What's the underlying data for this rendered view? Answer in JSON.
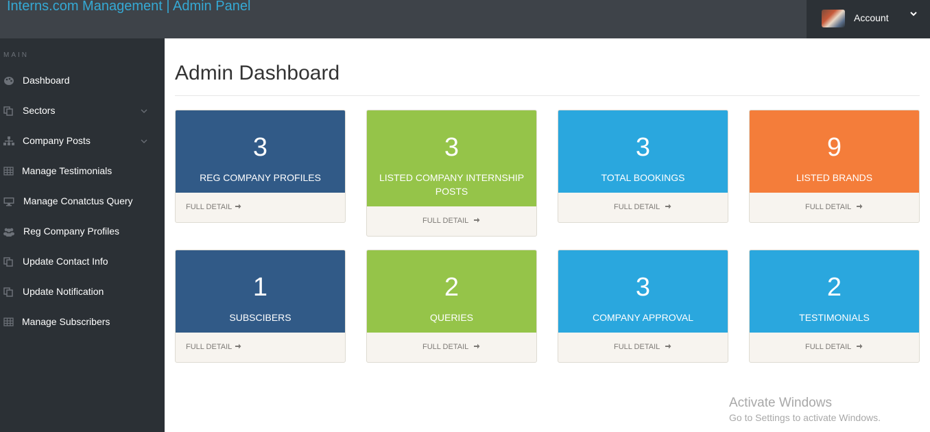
{
  "header": {
    "brand": "Interns.com Management | Admin Panel",
    "account_label": "Account"
  },
  "sidebar": {
    "heading": "MAIN",
    "items": [
      {
        "label": "Dashboard",
        "icon": "palette-icon"
      },
      {
        "label": "Sectors",
        "icon": "copy-icon",
        "has_submenu": true
      },
      {
        "label": "Company Posts",
        "icon": "sitemap-icon",
        "has_submenu": true
      },
      {
        "label": "Manage Testimonials",
        "icon": "table-icon"
      },
      {
        "label": "Manage Conatctus Query",
        "icon": "desktop-icon"
      },
      {
        "label": "Reg Company Profiles",
        "icon": "users-icon"
      },
      {
        "label": "Update Contact Info",
        "icon": "copy-icon"
      },
      {
        "label": "Update Notification",
        "icon": "copy-icon"
      },
      {
        "label": "Manage Subscribers",
        "icon": "table-icon"
      }
    ]
  },
  "main": {
    "title": "Admin Dashboard",
    "cards": [
      {
        "value": "3",
        "label": "REG COMPANY PROFILES",
        "link": "FULL DETAIL",
        "color": "#315a87"
      },
      {
        "value": "3",
        "label": "LISTED COMPANY INTERNSHIP POSTS",
        "link": "FULL DETAIL",
        "color": "#95c449"
      },
      {
        "value": "3",
        "label": "TOTAL BOOKINGS",
        "link": "FULL DETAIL",
        "color": "#2aa7de"
      },
      {
        "value": "9",
        "label": "LISTED BRANDS",
        "link": "FULL DETAIL",
        "color": "#f47d3a"
      },
      {
        "value": "1",
        "label": "SUBSCIBERS",
        "link": "FULL DETAIL",
        "color": "#315a87"
      },
      {
        "value": "2",
        "label": "QUERIES",
        "link": "FULL DETAIL",
        "color": "#95c449"
      },
      {
        "value": "3",
        "label": "COMPANY APPROVAL",
        "link": "FULL DETAIL",
        "color": "#2aa7de"
      },
      {
        "value": "2",
        "label": "TESTIMONIALS",
        "link": "FULL DETAIL",
        "color": "#2aa7de"
      }
    ]
  },
  "watermark": {
    "title": "Activate Windows",
    "subtitle": "Go to Settings to activate Windows."
  }
}
